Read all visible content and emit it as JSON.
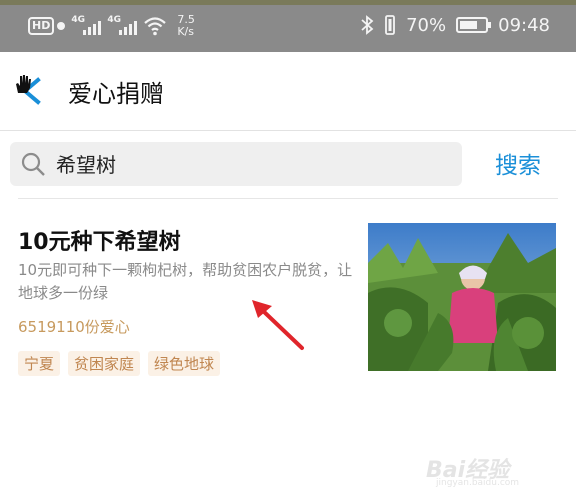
{
  "status_bar": {
    "hd": "HD",
    "sim1_gen": "4G",
    "sim2_gen": "4G",
    "speed_value": "7.5",
    "speed_unit": "K/s",
    "battery": "70%",
    "battery_level": 0.7,
    "time": "09:48"
  },
  "header": {
    "title": "爱心捐赠",
    "accent": "#1a8fd8"
  },
  "search": {
    "value": "希望树",
    "button": "搜索"
  },
  "card": {
    "title": "10元种下希望树",
    "description": "10元即可种下一颗枸杞树，帮助贫困农户脱贫，让地球多一份绿",
    "count": "6519110份爱心",
    "tags": [
      "宁夏",
      "贫困家庭",
      "绿色地球"
    ]
  },
  "watermark": {
    "text": "Bai经验",
    "sub": "jingyan.baidu.com"
  }
}
